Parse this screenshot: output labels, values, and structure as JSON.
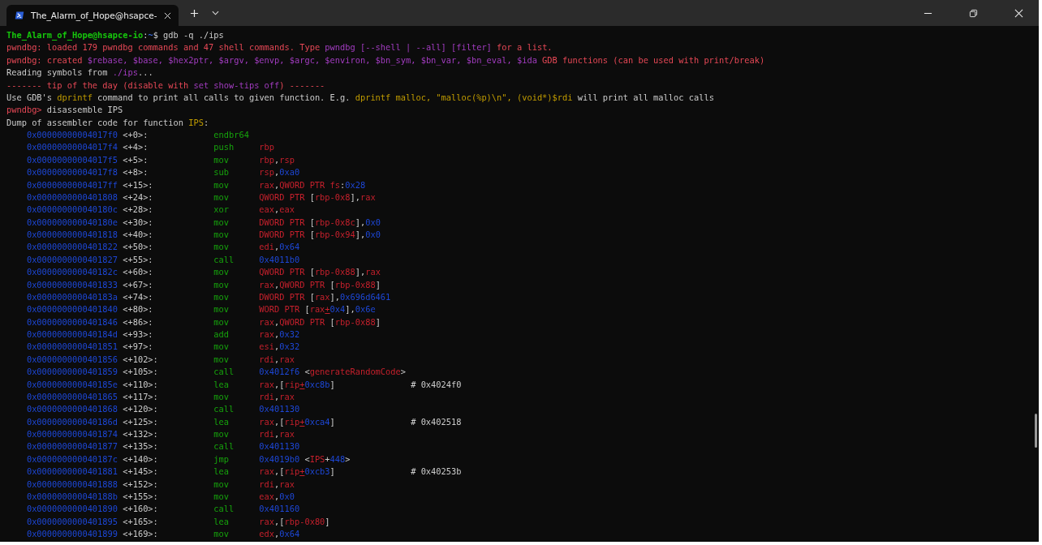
{
  "window": {
    "tab": {
      "title": "The_Alarm_of_Hope@hsapce-",
      "selected": true
    }
  },
  "terminal": {
    "lines": [
      {
        "segments": [
          {
            "kind": "user",
            "text": "The_Alarm_of_Hope@hsapce-io"
          },
          {
            "kind": "plain",
            "text": ":"
          },
          {
            "kind": "path",
            "text": "~"
          },
          {
            "kind": "plain",
            "text": "$ gdb -q ./ips"
          }
        ]
      },
      {
        "segments": [
          {
            "kind": "warn",
            "text": "pwndbg: loaded 179 pwndbg commands and 47 shell commands. Type "
          },
          {
            "kind": "accent",
            "text": "pwndbg [--shell | --all] [filter]"
          },
          {
            "kind": "warn",
            "text": " for a list."
          }
        ]
      },
      {
        "segments": [
          {
            "kind": "warn",
            "text": "pwndbg: created "
          },
          {
            "kind": "accent",
            "text": "$rebase, $base, $hex2ptr, $argv, $envp, $argc, $environ, $bn_sym, $bn_var, $bn_eval, $ida"
          },
          {
            "kind": "warn",
            "text": " GDB functions (can be used with print/break)"
          }
        ]
      },
      {
        "segments": [
          {
            "kind": "plain",
            "text": "Reading symbols from "
          },
          {
            "kind": "accent",
            "text": "./ips"
          },
          {
            "kind": "plain",
            "text": "..."
          }
        ]
      },
      {
        "segments": [
          {
            "kind": "warn",
            "text": "------- tip of the day (disable with "
          },
          {
            "kind": "accent",
            "text": "set show-tips off"
          },
          {
            "kind": "warn",
            "text": ") -------"
          }
        ]
      },
      {
        "segments": [
          {
            "kind": "plain",
            "text": "Use GDB's "
          },
          {
            "kind": "yellow",
            "text": "dprintf"
          },
          {
            "kind": "plain",
            "text": " command to print all calls to given function. E.g. "
          },
          {
            "kind": "yellow",
            "text": "dprintf malloc, \"malloc(%p)\\n\", (void*)$rdi"
          },
          {
            "kind": "plain",
            "text": " will print all malloc calls"
          }
        ]
      },
      {
        "segments": [
          {
            "kind": "warn",
            "text": "pwndbg>"
          },
          {
            "kind": "plain",
            "text": " disassemble IPS"
          }
        ]
      },
      {
        "segments": [
          {
            "kind": "plain",
            "text": "Dump of assembler code for function "
          },
          {
            "kind": "yellow",
            "text": "IPS"
          },
          {
            "kind": "plain",
            "text": ":"
          }
        ]
      }
    ],
    "disassembly": [
      {
        "address": "0x00000000004017f0",
        "offset": "<+0>:",
        "mnemonic": "endbr64"
      },
      {
        "address": "0x00000000004017f4",
        "offset": "<+4>:",
        "mnemonic": "push",
        "operands": [
          {
            "kind": "reg",
            "text": "rbp"
          }
        ]
      },
      {
        "address": "0x00000000004017f5",
        "offset": "<+5>:",
        "mnemonic": "mov",
        "operands": [
          {
            "kind": "reg",
            "text": "rbp"
          },
          {
            "kind": "punct",
            "text": ","
          },
          {
            "kind": "reg",
            "text": "rsp"
          }
        ]
      },
      {
        "address": "0x00000000004017f8",
        "offset": "<+8>:",
        "mnemonic": "sub",
        "operands": [
          {
            "kind": "reg",
            "text": "rsp"
          },
          {
            "kind": "punct",
            "text": ","
          },
          {
            "kind": "num",
            "text": "0xa0"
          }
        ]
      },
      {
        "address": "0x00000000004017ff",
        "offset": "<+15>:",
        "mnemonic": "mov",
        "operands": [
          {
            "kind": "reg",
            "text": "rax"
          },
          {
            "kind": "punct",
            "text": ","
          },
          {
            "kind": "reg",
            "text": "QWORD PTR fs"
          },
          {
            "kind": "punct",
            "text": ":"
          },
          {
            "kind": "num",
            "text": "0x28"
          }
        ]
      },
      {
        "address": "0x0000000000401808",
        "offset": "<+24>:",
        "mnemonic": "mov",
        "operands": [
          {
            "kind": "reg",
            "text": "QWORD PTR "
          },
          {
            "kind": "punct",
            "text": "["
          },
          {
            "kind": "reg",
            "text": "rbp-0x8"
          },
          {
            "kind": "punct",
            "text": "],"
          },
          {
            "kind": "reg",
            "text": "rax"
          }
        ]
      },
      {
        "address": "0x000000000040180c",
        "offset": "<+28>:",
        "mnemonic": "xor",
        "operands": [
          {
            "kind": "reg",
            "text": "eax"
          },
          {
            "kind": "punct",
            "text": ","
          },
          {
            "kind": "reg",
            "text": "eax"
          }
        ]
      },
      {
        "address": "0x000000000040180e",
        "offset": "<+30>:",
        "mnemonic": "mov",
        "operands": [
          {
            "kind": "reg",
            "text": "DWORD PTR "
          },
          {
            "kind": "punct",
            "text": "["
          },
          {
            "kind": "reg",
            "text": "rbp-0x8c"
          },
          {
            "kind": "punct",
            "text": "],"
          },
          {
            "kind": "num",
            "text": "0x0"
          }
        ]
      },
      {
        "address": "0x0000000000401818",
        "offset": "<+40>:",
        "mnemonic": "mov",
        "operands": [
          {
            "kind": "reg",
            "text": "DWORD PTR "
          },
          {
            "kind": "punct",
            "text": "["
          },
          {
            "kind": "reg",
            "text": "rbp-0x94"
          },
          {
            "kind": "punct",
            "text": "],"
          },
          {
            "kind": "num",
            "text": "0x0"
          }
        ]
      },
      {
        "address": "0x0000000000401822",
        "offset": "<+50>:",
        "mnemonic": "mov",
        "operands": [
          {
            "kind": "reg",
            "text": "edi"
          },
          {
            "kind": "punct",
            "text": ","
          },
          {
            "kind": "num",
            "text": "0x64"
          }
        ]
      },
      {
        "address": "0x0000000000401827",
        "offset": "<+55>:",
        "mnemonic": "call",
        "operands": [
          {
            "kind": "num",
            "text": "0x4011b0"
          }
        ]
      },
      {
        "address": "0x000000000040182c",
        "offset": "<+60>:",
        "mnemonic": "mov",
        "operands": [
          {
            "kind": "reg",
            "text": "QWORD PTR "
          },
          {
            "kind": "punct",
            "text": "["
          },
          {
            "kind": "reg",
            "text": "rbp-0x88"
          },
          {
            "kind": "punct",
            "text": "],"
          },
          {
            "kind": "reg",
            "text": "rax"
          }
        ]
      },
      {
        "address": "0x0000000000401833",
        "offset": "<+67>:",
        "mnemonic": "mov",
        "operands": [
          {
            "kind": "reg",
            "text": "rax"
          },
          {
            "kind": "punct",
            "text": ","
          },
          {
            "kind": "reg",
            "text": "QWORD PTR "
          },
          {
            "kind": "punct",
            "text": "["
          },
          {
            "kind": "reg",
            "text": "rbp-0x88"
          },
          {
            "kind": "punct",
            "text": "]"
          }
        ]
      },
      {
        "address": "0x000000000040183a",
        "offset": "<+74>:",
        "mnemonic": "mov",
        "operands": [
          {
            "kind": "reg",
            "text": "DWORD PTR "
          },
          {
            "kind": "punct",
            "text": "["
          },
          {
            "kind": "reg",
            "text": "rax"
          },
          {
            "kind": "punct",
            "text": "],"
          },
          {
            "kind": "num",
            "text": "0x696d6461"
          }
        ]
      },
      {
        "address": "0x0000000000401840",
        "offset": "<+80>:",
        "mnemonic": "mov",
        "operands": [
          {
            "kind": "reg",
            "text": "WORD PTR "
          },
          {
            "kind": "punct",
            "text": "["
          },
          {
            "kind": "reg",
            "text": "rax"
          },
          {
            "kind": "plus",
            "text": "+"
          },
          {
            "kind": "num",
            "text": "0x4"
          },
          {
            "kind": "punct",
            "text": "],"
          },
          {
            "kind": "num",
            "text": "0x6e"
          }
        ]
      },
      {
        "address": "0x0000000000401846",
        "offset": "<+86>:",
        "mnemonic": "mov",
        "operands": [
          {
            "kind": "reg",
            "text": "rax"
          },
          {
            "kind": "punct",
            "text": ","
          },
          {
            "kind": "reg",
            "text": "QWORD PTR "
          },
          {
            "kind": "punct",
            "text": "["
          },
          {
            "kind": "reg",
            "text": "rbp-0x88"
          },
          {
            "kind": "punct",
            "text": "]"
          }
        ]
      },
      {
        "address": "0x000000000040184d",
        "offset": "<+93>:",
        "mnemonic": "add",
        "operands": [
          {
            "kind": "reg",
            "text": "rax"
          },
          {
            "kind": "punct",
            "text": ","
          },
          {
            "kind": "num",
            "text": "0x32"
          }
        ]
      },
      {
        "address": "0x0000000000401851",
        "offset": "<+97>:",
        "mnemonic": "mov",
        "operands": [
          {
            "kind": "reg",
            "text": "esi"
          },
          {
            "kind": "punct",
            "text": ","
          },
          {
            "kind": "num",
            "text": "0x32"
          }
        ]
      },
      {
        "address": "0x0000000000401856",
        "offset": "<+102>:",
        "mnemonic": "mov",
        "operands": [
          {
            "kind": "reg",
            "text": "rdi"
          },
          {
            "kind": "punct",
            "text": ","
          },
          {
            "kind": "reg",
            "text": "rax"
          }
        ]
      },
      {
        "address": "0x0000000000401859",
        "offset": "<+105>:",
        "mnemonic": "call",
        "operands": [
          {
            "kind": "num",
            "text": "0x4012f6"
          },
          {
            "kind": "punct",
            "text": " <"
          },
          {
            "kind": "reg",
            "text": "generateRandomCode"
          },
          {
            "kind": "punct",
            "text": ">"
          }
        ]
      },
      {
        "address": "0x000000000040185e",
        "offset": "<+110>:",
        "mnemonic": "lea",
        "operands": [
          {
            "kind": "reg",
            "text": "rax"
          },
          {
            "kind": "punct",
            "text": ",["
          },
          {
            "kind": "reg",
            "text": "rip"
          },
          {
            "kind": "plus",
            "text": "+"
          },
          {
            "kind": "num",
            "text": "0xc8b"
          },
          {
            "kind": "punct",
            "text": "]"
          }
        ],
        "comment": "# 0x4024f0"
      },
      {
        "address": "0x0000000000401865",
        "offset": "<+117>:",
        "mnemonic": "mov",
        "operands": [
          {
            "kind": "reg",
            "text": "rdi"
          },
          {
            "kind": "punct",
            "text": ","
          },
          {
            "kind": "reg",
            "text": "rax"
          }
        ]
      },
      {
        "address": "0x0000000000401868",
        "offset": "<+120>:",
        "mnemonic": "call",
        "operands": [
          {
            "kind": "num",
            "text": "0x401130"
          }
        ]
      },
      {
        "address": "0x000000000040186d",
        "offset": "<+125>:",
        "mnemonic": "lea",
        "operands": [
          {
            "kind": "reg",
            "text": "rax"
          },
          {
            "kind": "punct",
            "text": ",["
          },
          {
            "kind": "reg",
            "text": "rip"
          },
          {
            "kind": "plus",
            "text": "+"
          },
          {
            "kind": "num",
            "text": "0xca4"
          },
          {
            "kind": "punct",
            "text": "]"
          }
        ],
        "comment": "# 0x402518"
      },
      {
        "address": "0x0000000000401874",
        "offset": "<+132>:",
        "mnemonic": "mov",
        "operands": [
          {
            "kind": "reg",
            "text": "rdi"
          },
          {
            "kind": "punct",
            "text": ","
          },
          {
            "kind": "reg",
            "text": "rax"
          }
        ]
      },
      {
        "address": "0x0000000000401877",
        "offset": "<+135>:",
        "mnemonic": "call",
        "operands": [
          {
            "kind": "num",
            "text": "0x401130"
          }
        ]
      },
      {
        "address": "0x000000000040187c",
        "offset": "<+140>:",
        "mnemonic": "jmp",
        "operands": [
          {
            "kind": "num",
            "text": "0x4019b0"
          },
          {
            "kind": "punct",
            "text": " <"
          },
          {
            "kind": "reg",
            "text": "IPS"
          },
          {
            "kind": "punct",
            "text": "+"
          },
          {
            "kind": "num",
            "text": "448"
          },
          {
            "kind": "punct",
            "text": ">"
          }
        ]
      },
      {
        "address": "0x0000000000401881",
        "offset": "<+145>:",
        "mnemonic": "lea",
        "operands": [
          {
            "kind": "reg",
            "text": "rax"
          },
          {
            "kind": "punct",
            "text": ",["
          },
          {
            "kind": "reg",
            "text": "rip"
          },
          {
            "kind": "plus",
            "text": "+"
          },
          {
            "kind": "num",
            "text": "0xcb3"
          },
          {
            "kind": "punct",
            "text": "]"
          }
        ],
        "comment": "# 0x40253b"
      },
      {
        "address": "0x0000000000401888",
        "offset": "<+152>:",
        "mnemonic": "mov",
        "operands": [
          {
            "kind": "reg",
            "text": "rdi"
          },
          {
            "kind": "punct",
            "text": ","
          },
          {
            "kind": "reg",
            "text": "rax"
          }
        ]
      },
      {
        "address": "0x000000000040188b",
        "offset": "<+155>:",
        "mnemonic": "mov",
        "operands": [
          {
            "kind": "reg",
            "text": "eax"
          },
          {
            "kind": "punct",
            "text": ","
          },
          {
            "kind": "num",
            "text": "0x0"
          }
        ]
      },
      {
        "address": "0x0000000000401890",
        "offset": "<+160>:",
        "mnemonic": "call",
        "operands": [
          {
            "kind": "num",
            "text": "0x401160"
          }
        ]
      },
      {
        "address": "0x0000000000401895",
        "offset": "<+165>:",
        "mnemonic": "lea",
        "operands": [
          {
            "kind": "reg",
            "text": "rax"
          },
          {
            "kind": "punct",
            "text": ",["
          },
          {
            "kind": "reg",
            "text": "rbp-0x80"
          },
          {
            "kind": "punct",
            "text": "]"
          }
        ]
      },
      {
        "address": "0x0000000000401899",
        "offset": "<+169>:",
        "mnemonic": "mov",
        "operands": [
          {
            "kind": "reg",
            "text": "edx"
          },
          {
            "kind": "punct",
            "text": ","
          },
          {
            "kind": "num",
            "text": "0x64"
          }
        ]
      }
    ]
  }
}
